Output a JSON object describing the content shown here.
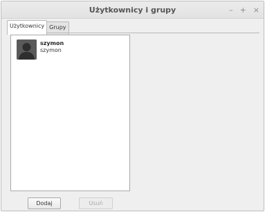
{
  "window": {
    "title": "Użytkownicy i grupy",
    "controls": [
      "–",
      "+",
      "×"
    ]
  },
  "tabs": [
    {
      "label": "Użytkownicy",
      "active": true
    },
    {
      "label": "Grupy",
      "active": false
    }
  ],
  "users": [
    {
      "name": "szymon",
      "login": "szymon",
      "avatar_icon": "person-silhouette-icon"
    }
  ],
  "buttons": {
    "add_label": "Dodaj",
    "remove_label": "Usuń",
    "remove_disabled": true
  },
  "colors": {
    "window_bg": "#efefef",
    "list_bg": "#ffffff",
    "disabled_text": "#a8a8a8"
  }
}
